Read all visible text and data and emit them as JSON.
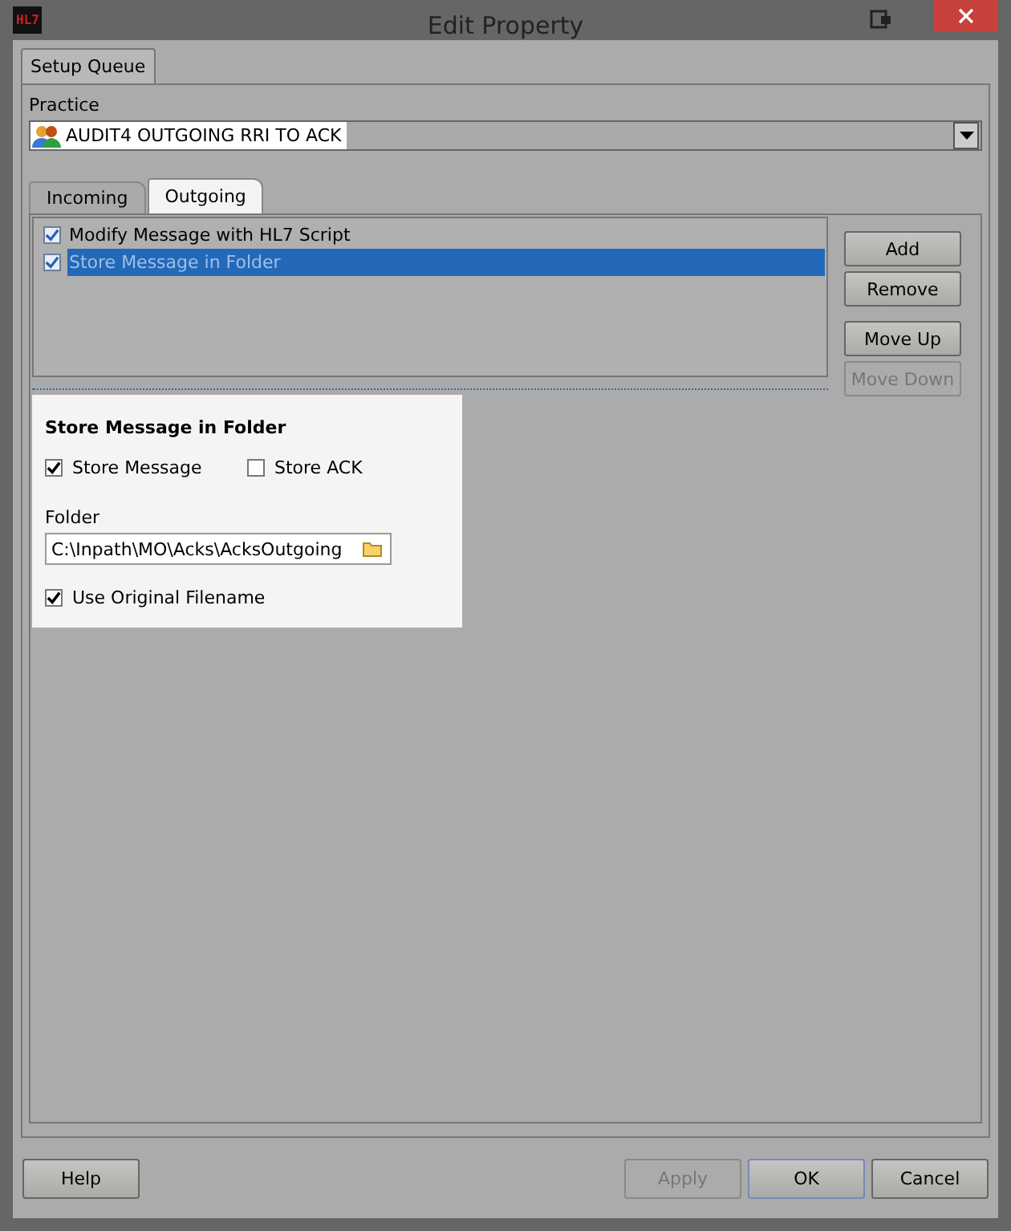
{
  "window": {
    "title": "Edit Property",
    "app_badge": "HL7"
  },
  "outer_tabs": [
    {
      "label": "Setup Queue",
      "selected": true
    }
  ],
  "practice": {
    "label": "Practice",
    "value": "AUDIT4 OUTGOING RRI TO ACK"
  },
  "inner_tabs": [
    {
      "label": "Incoming",
      "selected": false
    },
    {
      "label": "Outgoing",
      "selected": true
    }
  ],
  "steps": [
    {
      "label": "Modify Message with HL7 Script",
      "checked": true,
      "selected": false
    },
    {
      "label": "Store Message in Folder",
      "checked": true,
      "selected": true
    }
  ],
  "step_buttons": [
    {
      "label": "Add",
      "disabled": false
    },
    {
      "label": "Remove",
      "disabled": false
    },
    {
      "label": "Move Up",
      "disabled": false
    },
    {
      "label": "Move Down",
      "disabled": true
    }
  ],
  "detail": {
    "title": "Store Message in Folder",
    "options": [
      {
        "label": "Store Message",
        "checked": true
      },
      {
        "label": "Store ACK",
        "checked": false
      }
    ],
    "folder_label": "Folder",
    "folder_value": "C:\\Inpath\\MO\\Acks\\AcksOutgoing",
    "use_original": {
      "label": "Use Original Filename",
      "checked": true
    }
  },
  "footer_left": [
    {
      "label": "Help",
      "disabled": false,
      "default": false
    }
  ],
  "footer_right": [
    {
      "label": "Apply",
      "disabled": true,
      "default": false
    },
    {
      "label": "OK",
      "disabled": false,
      "default": true
    },
    {
      "label": "Cancel",
      "disabled": false,
      "default": false
    }
  ]
}
